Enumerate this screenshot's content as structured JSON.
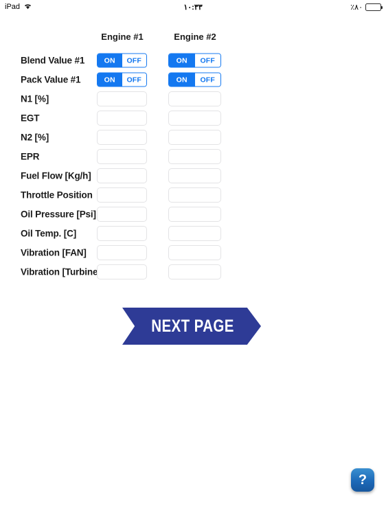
{
  "statusbar": {
    "device": "iPad",
    "wifi_icon": "wifi-icon",
    "time": "١٠:٣٣",
    "battery_pct": "٪٨٠",
    "battery_icon": "battery-icon"
  },
  "form": {
    "columns": [
      {
        "label": "Engine #1"
      },
      {
        "label": "Engine #2"
      }
    ],
    "toggle_rows": [
      {
        "label": "Blend Value #1",
        "cells": [
          {
            "on_label": "ON",
            "off_label": "OFF",
            "selected": "ON"
          },
          {
            "on_label": "ON",
            "off_label": "OFF",
            "selected": "ON"
          }
        ]
      },
      {
        "label": "Pack Value #1",
        "cells": [
          {
            "on_label": "ON",
            "off_label": "OFF",
            "selected": "ON"
          },
          {
            "on_label": "ON",
            "off_label": "OFF",
            "selected": "ON"
          }
        ]
      }
    ],
    "field_rows": [
      {
        "label": "N1 [%]",
        "values": [
          "",
          ""
        ],
        "placeholder": ""
      },
      {
        "label": "EGT",
        "values": [
          "",
          ""
        ],
        "placeholder": ""
      },
      {
        "label": "N2 [%]",
        "values": [
          "",
          ""
        ],
        "placeholder": ""
      },
      {
        "label": "EPR",
        "values": [
          "",
          ""
        ],
        "placeholder": ""
      },
      {
        "label": "Fuel Flow [Kg/h]",
        "values": [
          "",
          ""
        ],
        "placeholder": ""
      },
      {
        "label": "Throttle Position",
        "values": [
          "",
          ""
        ],
        "placeholder": ""
      },
      {
        "label": "Oil Pressure [Psi]",
        "values": [
          "",
          ""
        ],
        "placeholder": ""
      },
      {
        "label": "Oil Temp. [C]",
        "values": [
          "",
          ""
        ],
        "placeholder": ""
      },
      {
        "label": "Vibration [FAN]",
        "values": [
          "",
          ""
        ],
        "placeholder": ""
      },
      {
        "label": "Vibration [Turbine]",
        "values": [
          "",
          ""
        ],
        "placeholder": ""
      }
    ]
  },
  "next_page": {
    "label": "NEXT PAGE",
    "color": "#2e3b96"
  },
  "help": {
    "label": "?",
    "icon": "question-mark-icon",
    "color": "#1d69b8"
  },
  "colors": {
    "accent_blue": "#1478f0",
    "ribbon_blue": "#2e3b96",
    "field_border": "#e3e3e5",
    "page_background": "#ffffff"
  }
}
